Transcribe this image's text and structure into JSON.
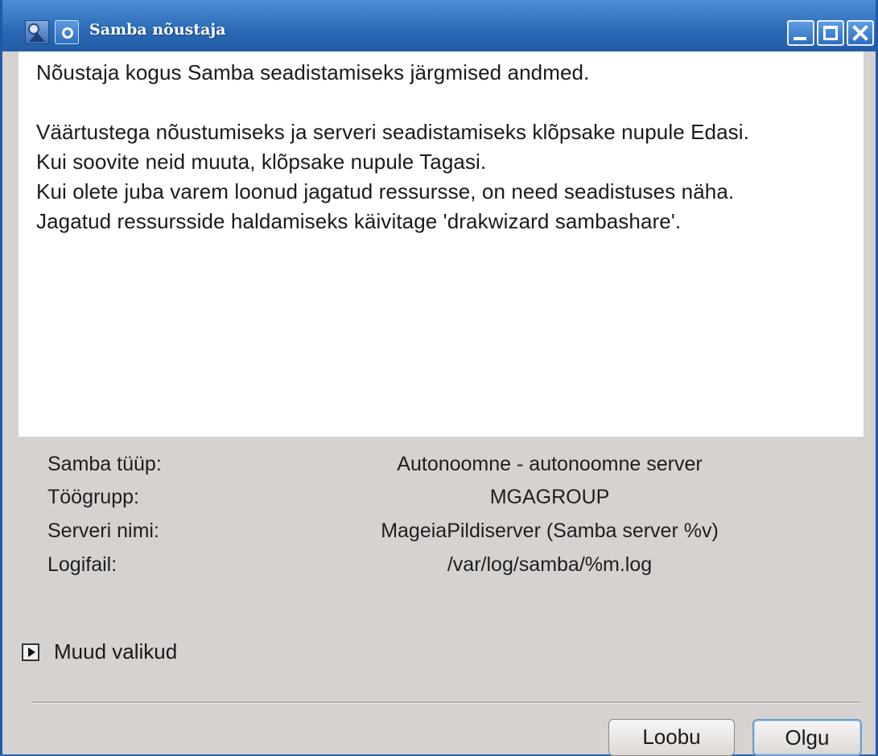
{
  "window": {
    "title": "Samba nõustaja"
  },
  "intro": {
    "line1": "Nõustaja kogus Samba seadistamiseks järgmised andmed.",
    "line2": "Väärtustega nõustumiseks ja serveri seadistamiseks klõpsake nupule Edasi.",
    "line3": "Kui soovite neid muuta, klõpsake nupule Tagasi.",
    "line4": "Kui olete juba varem loonud jagatud ressursse, on need seadistuses näha.",
    "line5": "Jagatud ressursside haldamiseks käivitage 'drakwizard sambashare'."
  },
  "summary": [
    {
      "label": "Samba tüüp:",
      "value": "Autonoomne - autonoomne server"
    },
    {
      "label": "Töögrupp:",
      "value": "MGAGROUP"
    },
    {
      "label": "Serveri nimi:",
      "value": "MageiaPildiserver (Samba server %v)"
    },
    {
      "label": "Logifail:",
      "value": "/var/log/samba/%m.log"
    }
  ],
  "expander": {
    "label": "Muud valikud"
  },
  "buttons": {
    "cancel": "Loobu",
    "ok": "Olgu"
  }
}
